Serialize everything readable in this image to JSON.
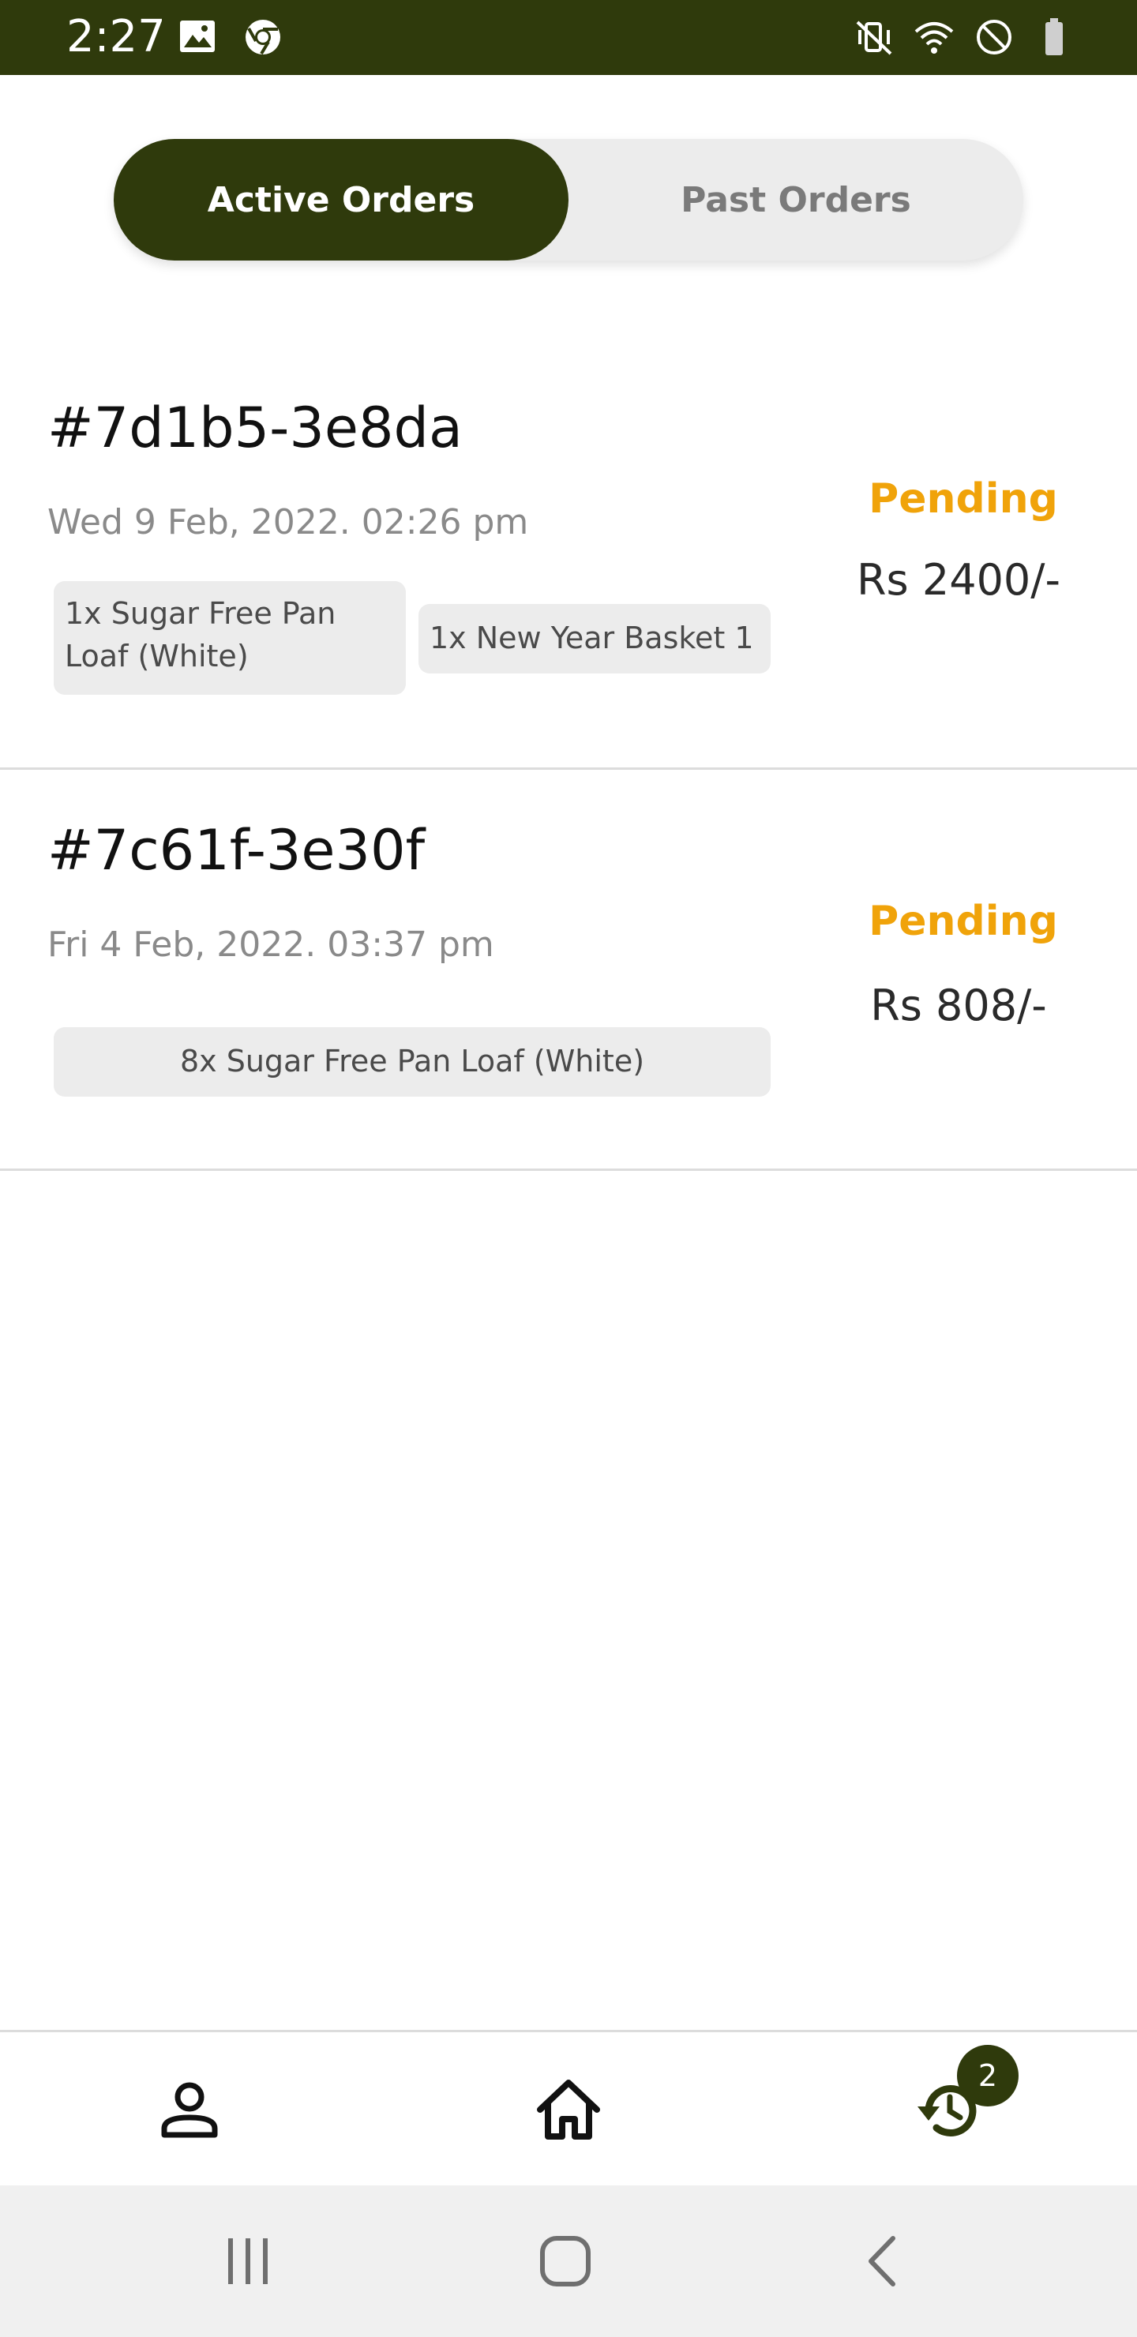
{
  "status_bar": {
    "time": "2:27",
    "background": "#2f3a0c",
    "left_icons": [
      "image-icon",
      "chrome-icon"
    ],
    "right_icons": [
      "mute-vibrate-icon",
      "wifi-icon",
      "do-not-disturb-icon",
      "battery-icon"
    ]
  },
  "tabs": {
    "active_label": "Active Orders",
    "inactive_label": "Past Orders",
    "selected": "Active Orders"
  },
  "orders": [
    {
      "id": "#7d1b5-3e8da",
      "date": "Wed 9 Feb, 2022. 02:26 pm",
      "items": [
        "1x Sugar Free Pan Loaf (White)",
        "1x New Year Basket 1"
      ],
      "status": "Pending",
      "price": "Rs 2400/-"
    },
    {
      "id": "#7c61f-3e30f",
      "date": "Fri 4 Feb, 2022. 03:37 pm",
      "items": [
        "8x Sugar Free Pan Loaf (White)"
      ],
      "status": "Pending",
      "price": "Rs 808/-"
    }
  ],
  "bottom_nav": {
    "items": [
      {
        "icon": "profile-icon"
      },
      {
        "icon": "home-icon"
      },
      {
        "icon": "order-history-icon",
        "badge": "2"
      }
    ]
  },
  "system_nav": [
    "recent-apps-icon",
    "home-button-icon",
    "back-icon"
  ],
  "colors": {
    "brand": "#2f3a0c",
    "pending": "#f0a30a",
    "chip_bg": "#ececec"
  }
}
